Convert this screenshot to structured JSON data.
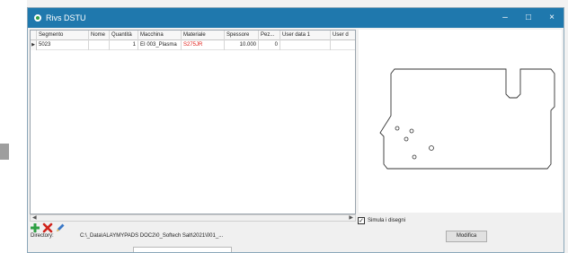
{
  "window": {
    "title": "Rivs DSTU",
    "controls": {
      "minimize": "–",
      "maximize": "□",
      "close": "×"
    }
  },
  "grid": {
    "columns": [
      "Segmento",
      "Nome",
      "Quantità",
      "Macchina",
      "Materiale",
      "Spessore",
      "Pez...",
      "User data 1",
      "User d"
    ],
    "rows": [
      {
        "indicator": "▶",
        "cells": [
          "5023",
          "",
          "1",
          "EI 003_Plasma",
          "S275JR",
          "10.000",
          "0",
          "",
          ""
        ]
      }
    ],
    "highlight_color": "#e0201b"
  },
  "scroll": {
    "left_arrow": "◀",
    "right_arrow": "▶"
  },
  "toolbar": {
    "add_icon": "plus-icon",
    "delete_icon": "x-icon",
    "edit_icon": "pencil-icon"
  },
  "options": {
    "simula_label": "Simula i disegni",
    "simula_checked": true,
    "checkmark": "✓"
  },
  "directory": {
    "label": "Directory:",
    "value": "C:\\_Data\\ALAYMYPADS DOC2\\0_Softech Salt\\2021\\001_..."
  },
  "buttons": {
    "modify": "Modifica"
  },
  "colors": {
    "titlebar": "#1f78ad",
    "add": "#2ea043",
    "delete": "#d0231b",
    "edit": "#3a78c7"
  }
}
